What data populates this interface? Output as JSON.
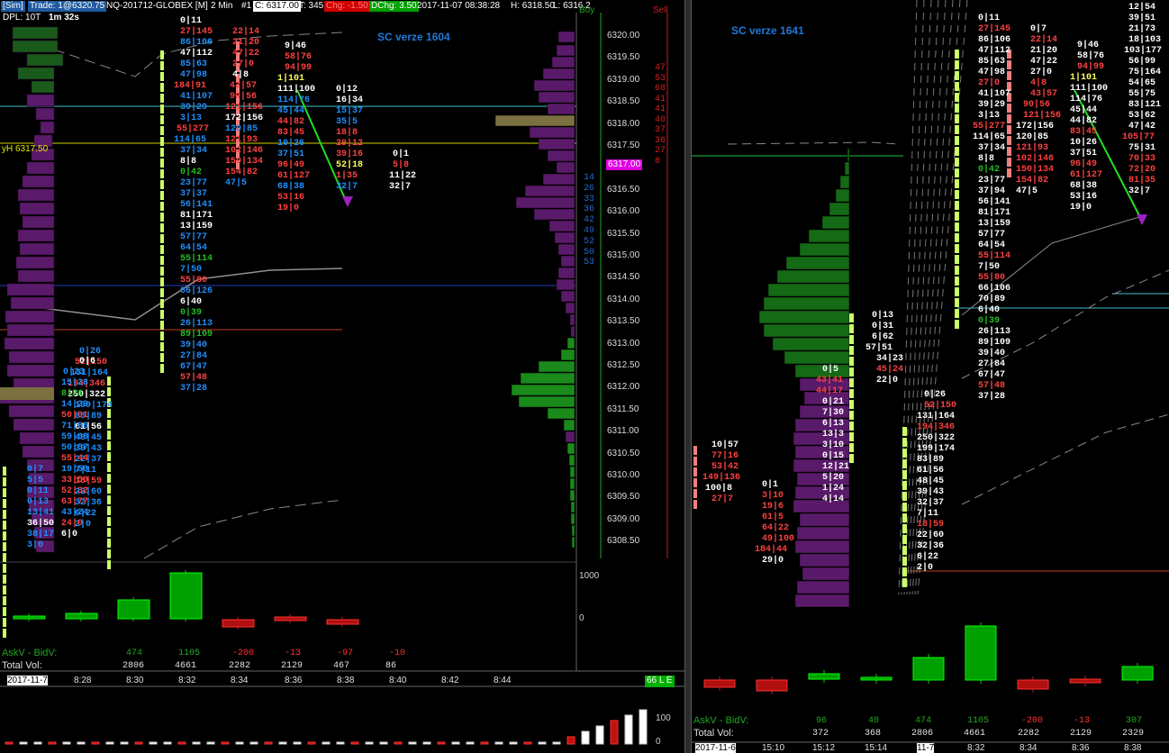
{
  "left": {
    "header": {
      "sim": "[Sim]",
      "trade": "Trade: 1@6320.75",
      "instrument": "NQ-201712-GLOBEX [M]",
      "interval": "2 Min",
      "num": "#1",
      "close": "C: 6317.00",
      "ticks": "T: 345",
      "chg": "Chg: -1.50",
      "dchg": "DChg: 3.50",
      "datetime": "2017-11-07 08:38:28",
      "high": "H: 6318.50",
      "low": "L: 6316.2"
    },
    "dpl": "DPL: 10T",
    "timer": "1m 32s",
    "sc_label": "SC verze 1604",
    "yh_label": "yH 6317.50",
    "buy_label": "Buy",
    "sell_label": "Sell",
    "price_axis": [
      "6320.00",
      "6319.50",
      "6319.00",
      "6318.50",
      "6318.00",
      "6317.50",
      "6317.00",
      "6316.50",
      "6316.00",
      "6315.50",
      "6315.00",
      "6314.50",
      "6314.00",
      "6313.50",
      "6313.00",
      "6312.50",
      "6312.00",
      "6311.50",
      "6311.00",
      "6310.50",
      "6310.00",
      "6309.50",
      "6309.00",
      "6308.50"
    ],
    "current_price": "6317.00",
    "sell_numbers": [
      "47",
      "53",
      "68",
      "41",
      "41",
      "40",
      "37",
      "36",
      "27",
      "8"
    ],
    "buy_numbers": [
      "14",
      "26",
      "33",
      "36",
      "42",
      "49",
      "52",
      "50",
      "53"
    ],
    "vol_axis": [
      "1000",
      "0"
    ],
    "askbid_label": "AskV - BidV:",
    "askbid_values": [
      "474",
      "1105",
      "-200",
      "-13",
      "-97",
      "-10"
    ],
    "totalvol_label": "Total Vol:",
    "totalvol_values": [
      "2806",
      "4661",
      "2282",
      "2129",
      "467",
      "86"
    ],
    "time_axis": [
      "2017-11-7",
      "8:28",
      "8:30",
      "8:32",
      "8:34",
      "8:36",
      "8:38",
      "8:40",
      "8:42",
      "8:44"
    ],
    "corner_badge": "66 L E",
    "mini_axis": [
      "100",
      "0"
    ]
  },
  "right": {
    "sc_label": "SC verze 1641",
    "askbid_label": "AskV - BidV:",
    "askbid_values": [
      "96",
      "40",
      "474",
      "1105",
      "-200",
      "-13",
      "307"
    ],
    "totalvol_label": "Total Vol:",
    "totalvol_values": [
      "372",
      "368",
      "2806",
      "4661",
      "2282",
      "2129",
      "2329"
    ],
    "time_axis": [
      "2017-11-6",
      "15:10",
      "15:12",
      "15:14",
      "11-7",
      "8:32",
      "8:34",
      "8:36",
      "8:38"
    ]
  },
  "colors": {
    "ask": "#1e90ff",
    "bid": "#ff4040",
    "green": "#1fa81f",
    "purple": "#5a1a6a",
    "candle_up": "#00cc00",
    "candle_down": "#cc1010"
  }
}
